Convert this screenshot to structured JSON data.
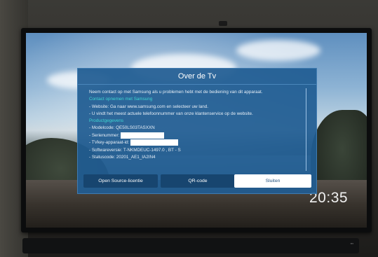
{
  "dialog": {
    "title": "Over de Tv",
    "intro": "Neem contact op met Samsung als u problemen hebt met de bediening van dit apparaat.",
    "contact_heading": "Contact opnemen met Samsung",
    "contact_website": "- Website: Ga naar www.samsung.com en selecteer uw land.",
    "contact_phone": "- U vindt het meest actuele telefoonnummer van onze klantenservice op de website.",
    "product_heading": "Productgegevens",
    "model_code": "- Modelcode: QE50LS03TASXXN",
    "serial_label": "- Serienummer:",
    "tvkey_label": "- TVkey-apparaat-id:",
    "software_version": "- Softwareversie: T-NKMDEUC-1497.0 , BT - S",
    "status_code": "- Statuscode: 20201_AE1_IA2IN4",
    "buttons": {
      "open_source": "Open Source-licentie",
      "qr_code": "QR-code",
      "close": "Sluiten"
    }
  },
  "clock": "20:35",
  "colors": {
    "dialog_bg": "#205c92",
    "heading_accent": "#3fd6d2",
    "selected_button": "#ffffff"
  }
}
